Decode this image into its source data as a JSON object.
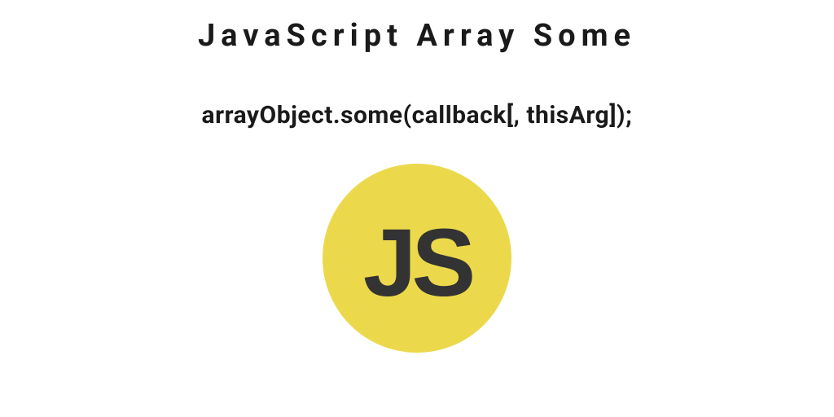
{
  "header": {
    "title": "JavaScript Array Some"
  },
  "content": {
    "code": "arrayObject.some(callback[, thisArg]);"
  },
  "logo": {
    "label": "JS",
    "background": "#ecd94b",
    "text_color": "#333333"
  }
}
